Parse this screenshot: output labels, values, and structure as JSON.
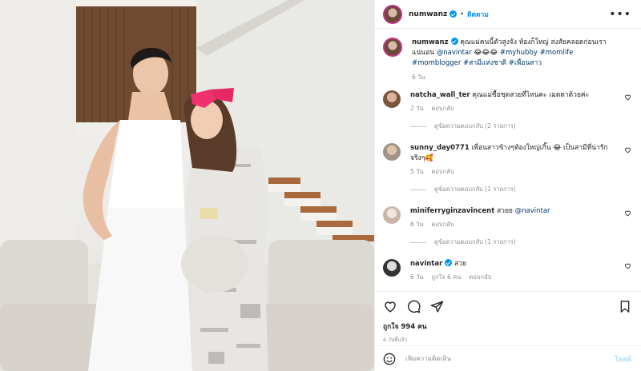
{
  "header": {
    "username": "numwanz",
    "separator": "•",
    "follow_label": "ติดตาม",
    "more_label": "•••"
  },
  "caption": {
    "username": "numwanz",
    "text_before_mention": " คุณแม่คนนี้ตัวสูงจัง ท้องก็ใหญ่ สงสัยคลอดก่อนเราแน่นอน ",
    "mention": "@navintar",
    "text_after_mention": " 😂😂😂 ",
    "hashtags": "#myhubby #momlife #momblogger #สามีแห่งชาติ #เพื่อนสาว",
    "time": "6 วัน"
  },
  "comments": [
    {
      "username": "natcha_wall_ter",
      "text": " คุณแม่ซื้อชุดสวยที่ไหนคะ เมดดาด้วยค่ะ",
      "time": "2 วัน",
      "reply_label": "ตอบกลับ",
      "view_replies": "ดูข้อความตอบกลับ (2 รายการ)"
    },
    {
      "username": "sunny_day0771",
      "text": " เพื่อนสาวข้างๆท้องใหญ่เกิ๊น 😂 เป็นสามีที่น่ารักจริงๆ🥰",
      "time": "5 วัน",
      "reply_label": "ตอบกลับ",
      "view_replies": "ดูข้อความตอบกลับ (1 รายการ)"
    },
    {
      "username": "miniferryginzavincent",
      "text": " สวยย ",
      "mention": "@navintar",
      "time": "6 วัน",
      "reply_label": "ตอบกลับ",
      "view_replies": "ดูข้อความตอบกลับ (1 รายการ)"
    },
    {
      "username": "navintar",
      "text": " สวย",
      "time": "6 วัน",
      "likes": "ถูกใจ 6 คน",
      "reply_label": "ตอบกลับ"
    }
  ],
  "actions": {
    "likes_label": "ถูกใจ 994 คน",
    "date": "6 วันที่แล้ว"
  },
  "add_comment": {
    "placeholder": "เพิ่มความคิดเห็น",
    "post_label": "โพสต์"
  },
  "colors": {
    "accent": "#0095f6",
    "link": "#00376b",
    "muted": "#8e8e8e",
    "bow": "#f0306f"
  },
  "icons": [
    "verified-icon",
    "more-icon",
    "heart-icon",
    "comment-icon",
    "share-icon",
    "bookmark-icon",
    "emoji-icon"
  ]
}
